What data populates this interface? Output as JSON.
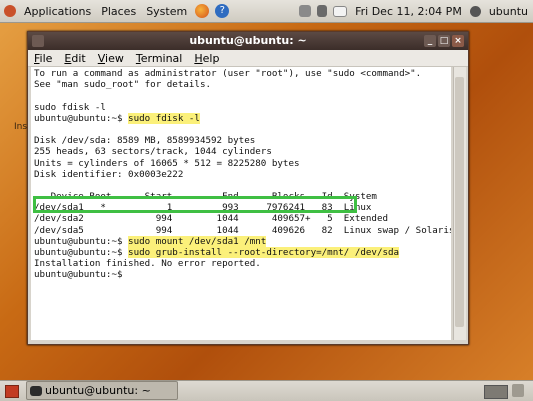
{
  "top_panel": {
    "menus": [
      "Applications",
      "Places",
      "System"
    ],
    "clock": "Fri Dec 11,  2:04 PM",
    "user": "ubuntu"
  },
  "desktop": {
    "partial_label": "Ins"
  },
  "window": {
    "title": "ubuntu@ubuntu: ~",
    "menu": [
      {
        "label": "File",
        "u": "F",
        "rest": "ile"
      },
      {
        "label": "Edit",
        "u": "E",
        "rest": "dit"
      },
      {
        "label": "View",
        "u": "V",
        "rest": "iew"
      },
      {
        "label": "Terminal",
        "u": "T",
        "rest": "erminal"
      },
      {
        "label": "Help",
        "u": "H",
        "rest": "elp"
      }
    ]
  },
  "terminal": {
    "lines": [
      {
        "text": "To run a command as administrator (user \"root\"), use \"sudo <command>\"."
      },
      {
        "text": "See \"man sudo_root\" for details."
      },
      {
        "text": ""
      },
      {
        "text": "sudo fdisk -l"
      },
      {
        "prompt": "ubuntu@ubuntu:~$ ",
        "cmd": "sudo fdisk -l"
      },
      {
        "text": ""
      },
      {
        "text": "Disk /dev/sda: 8589 MB, 8589934592 bytes"
      },
      {
        "text": "255 heads, 63 sectors/track, 1044 cylinders"
      },
      {
        "text": "Units = cylinders of 16065 * 512 = 8225280 bytes"
      },
      {
        "text": "Disk identifier: 0x0003e222"
      },
      {
        "text": ""
      },
      {
        "text": "   Device Boot      Start         End      Blocks   Id  System"
      },
      {
        "text": "/dev/sda1   *           1         993     7976241   83  Linux"
      },
      {
        "text": "/dev/sda2             994        1044      409657+   5  Extended"
      },
      {
        "text": "/dev/sda5             994        1044      409626   82  Linux swap / Solaris"
      },
      {
        "prompt": "ubuntu@ubuntu:~$ ",
        "cmd": "sudo mount /dev/sda1 /mnt"
      },
      {
        "prompt": "ubuntu@ubuntu:~$ ",
        "cmd": "sudo grub-install --root-directory=/mnt/ /dev/sda"
      },
      {
        "text": "Installation finished. No error reported."
      },
      {
        "prompt": "ubuntu@ubuntu:~$ ",
        "cmd": ""
      }
    ]
  },
  "taskbar": {
    "task_label": "ubuntu@ubuntu: ~"
  }
}
